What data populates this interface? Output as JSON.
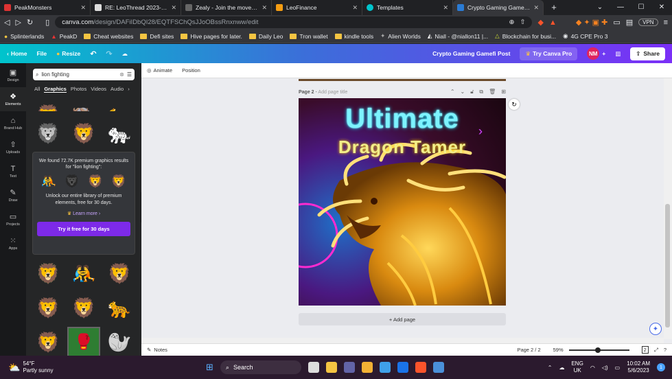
{
  "browser": {
    "tabs": [
      {
        "title": "PeakMonsters",
        "color": "#d33"
      },
      {
        "title": "RE: LeoThread 2023-05-06 03:15",
        "color": "#ddd"
      },
      {
        "title": "Zealy - Join the movement",
        "color": "#333"
      },
      {
        "title": "LeoFinance",
        "color": "#f39c12"
      },
      {
        "title": "Templates",
        "color": "#00c4cc"
      },
      {
        "title": "Crypto Gaming Gamefi Post",
        "color": "#2a7bd4"
      }
    ],
    "url_host": "canva.com",
    "url_path": "/design/DAFiIDbQI28/EQTFSChQsJJoOBssRnxnww/edit",
    "vpn": "VPN",
    "bookmarks": [
      "Splinterlands",
      "PeakD",
      "Cheat websites",
      "Defi sites",
      "Hive pages for later.",
      "Daily Leo",
      "Tron wallet",
      "kindle tools",
      "Alien Worlds",
      "Niall - @niallon11 |...",
      "Blockchain for busi...",
      "4G CPE Pro 3"
    ]
  },
  "canva": {
    "home": "Home",
    "file": "File",
    "resize": "Resize",
    "design_title": "Crypto Gaming Gamefi Post",
    "try_pro": "Try Canva Pro",
    "avatar": "NM",
    "share": "Share",
    "rail": [
      "Design",
      "Elements",
      "Brand Hub",
      "Uploads",
      "Text",
      "Draw",
      "Projects",
      "Apps"
    ],
    "search_value": "lion fighting",
    "categories": [
      "All",
      "Graphics",
      "Photos",
      "Videos",
      "Audio"
    ],
    "promo": {
      "found": "We found 72.7K premium graphics results for \"lion fighting\":",
      "unlock": "Unlock our entire library of premium elements, free for 30 days.",
      "learn": "Learn more",
      "button": "Try it free for 30 days"
    },
    "context": {
      "animate": "Animate",
      "position": "Position"
    },
    "page_label": "Page 2",
    "page_title_placeholder": "Add page title",
    "design_text_1": "Ultimate",
    "design_text_2": "Dragon Tamer",
    "add_page": "+ Add page",
    "notes": "Notes",
    "page_count": "Page 2 / 2",
    "zoom": "59%",
    "zoom_level": 0.59
  },
  "taskbar": {
    "temp": "54°F",
    "weather": "Partly sunny",
    "search": "Search",
    "lang1": "ENG",
    "lang2": "UK",
    "time": "10:02 AM",
    "date": "5/6/2023",
    "notifications": "1"
  }
}
